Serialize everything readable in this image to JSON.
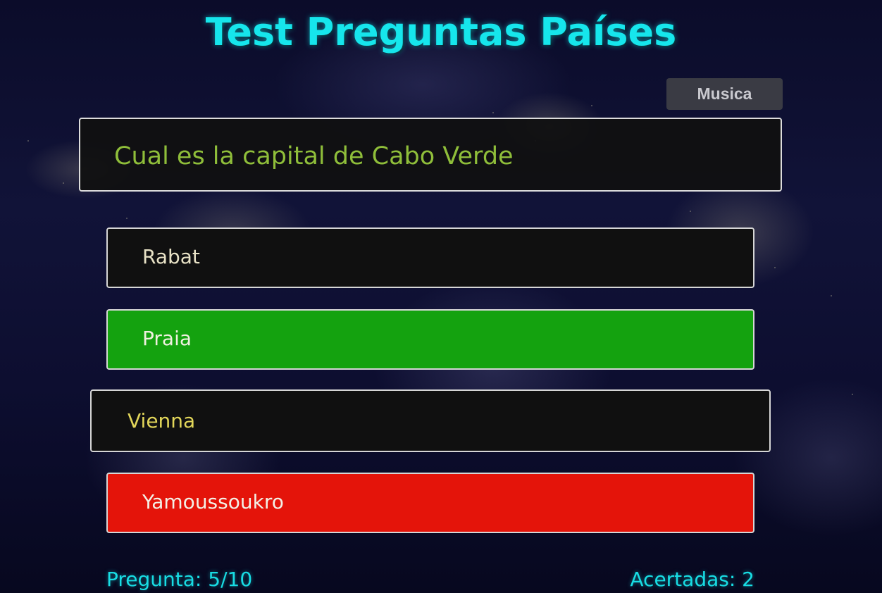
{
  "page": {
    "title": "Test Preguntas Países"
  },
  "controls": {
    "music_label": "Musica"
  },
  "question": {
    "text": "Cual es la capital de Cabo Verde"
  },
  "answers": [
    {
      "label": "Rabat",
      "state": "neutral"
    },
    {
      "label": "Praia",
      "state": "correct"
    },
    {
      "label": "Vienna",
      "state": "hover"
    },
    {
      "label": "Yamoussoukro",
      "state": "wrong"
    }
  ],
  "status": {
    "progress_text": "Pregunta: 5/10",
    "score_text": "Acertadas: 2"
  },
  "colors": {
    "title": "#16e6ec",
    "question_text": "#8fbe3a",
    "correct": "#14a20f",
    "wrong": "#e4140a",
    "box_bg": "#101010",
    "footer_text": "#18dde4"
  }
}
